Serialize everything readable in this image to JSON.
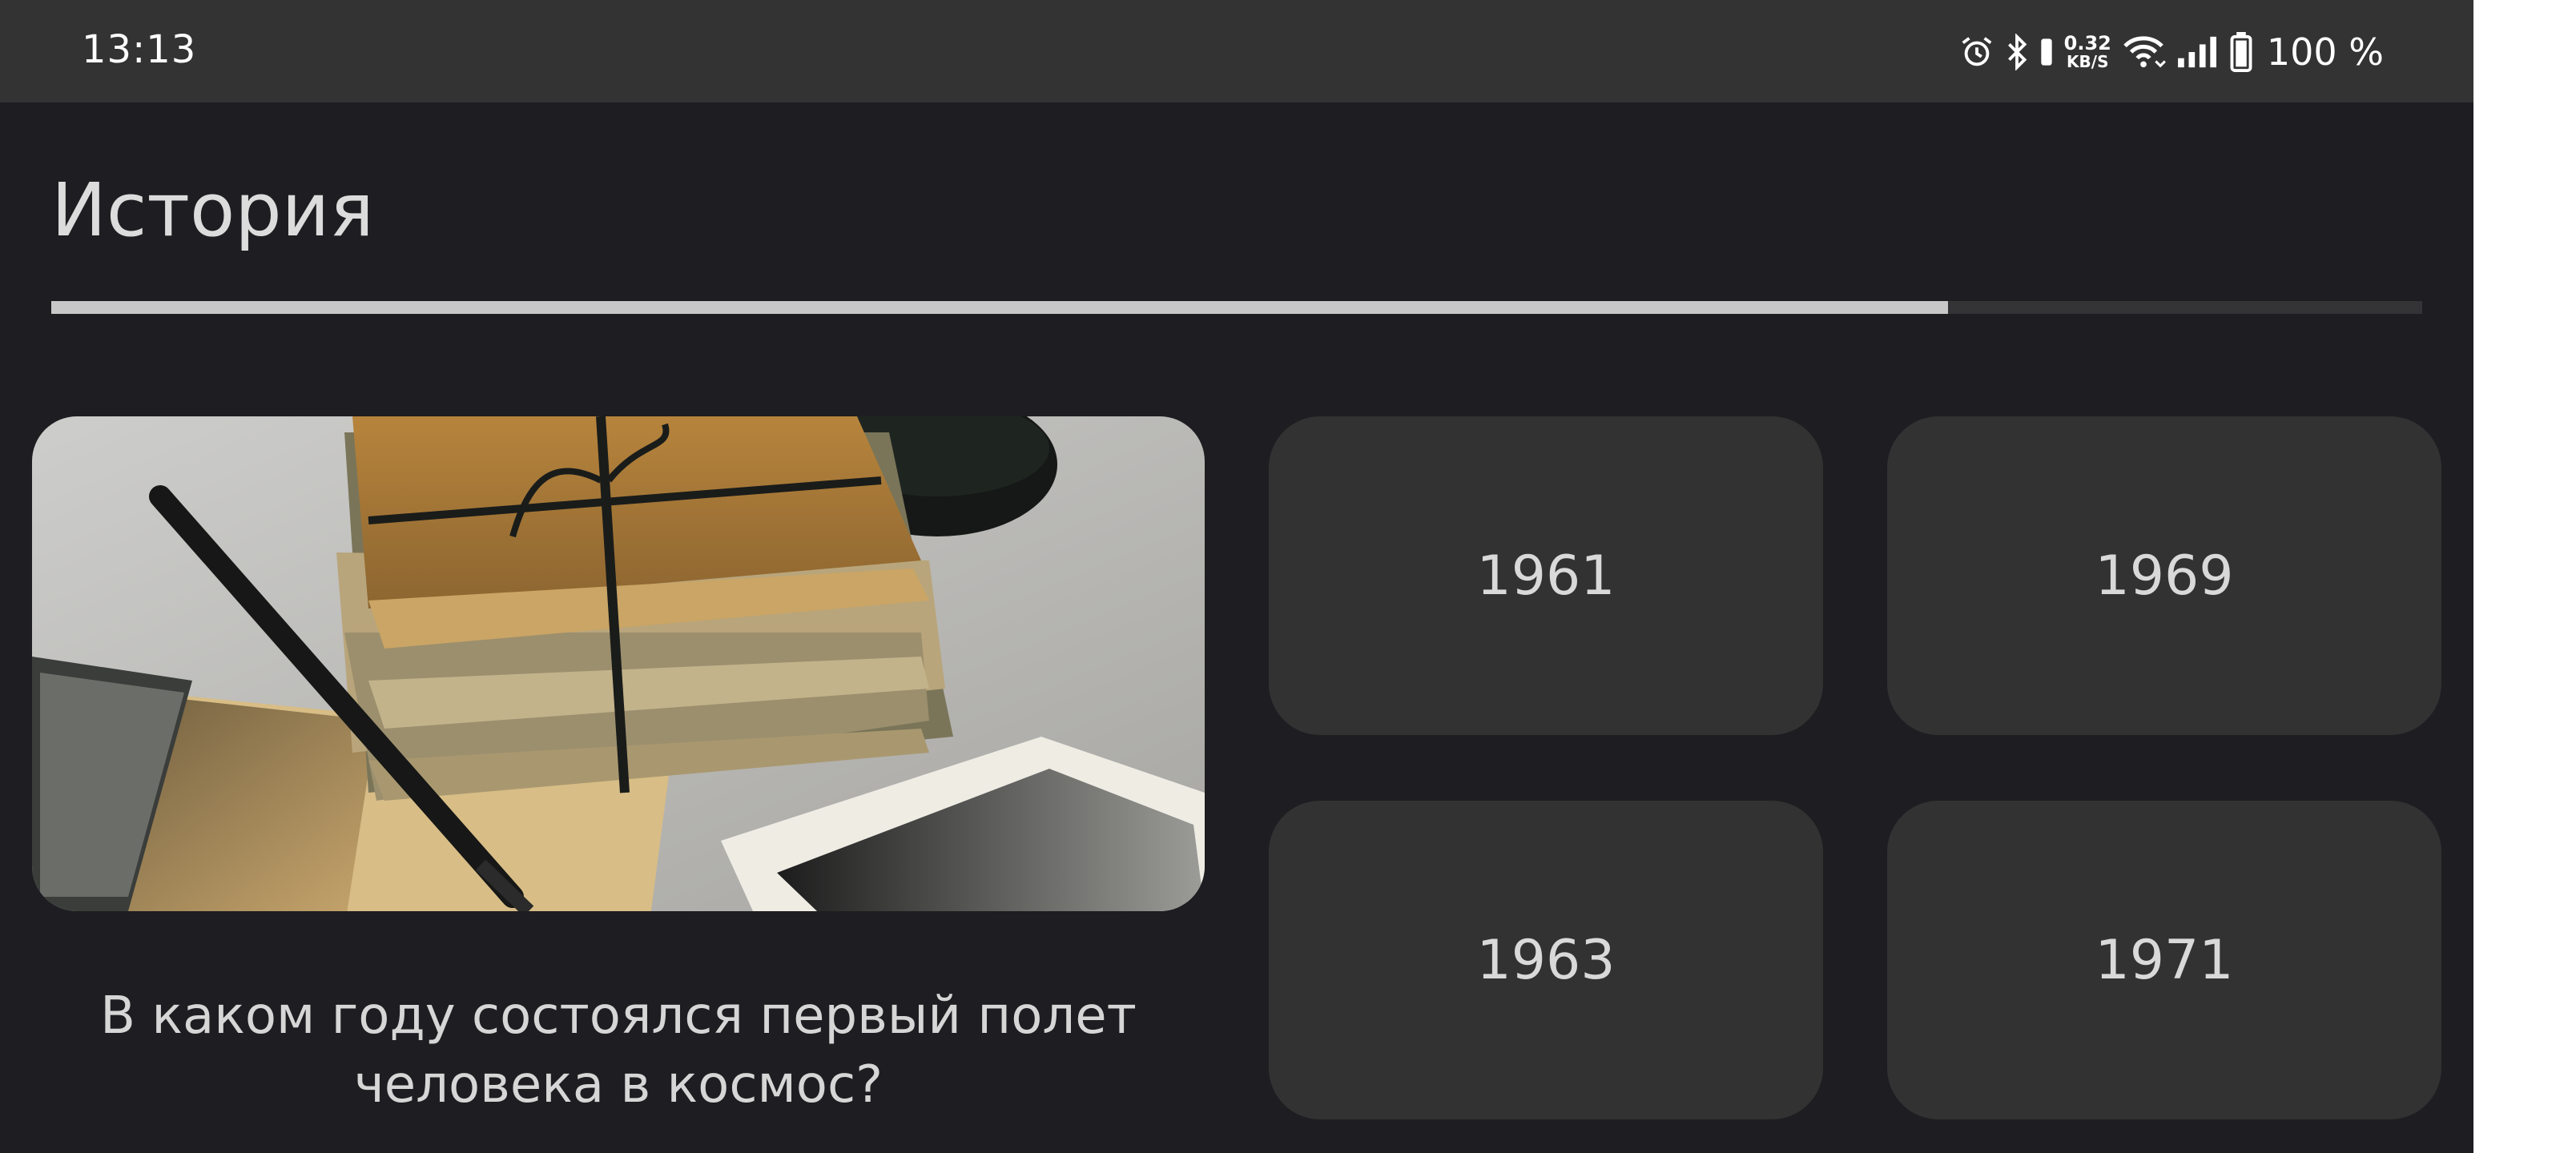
{
  "status_bar": {
    "time": "13:13",
    "net_speed_value": "0.32",
    "net_speed_unit": "KB/S",
    "battery_text": "100 %",
    "icons": [
      "alarm-icon",
      "bluetooth-icon",
      "vibrate-icon",
      "wifi-icon",
      "signal-icon",
      "battery-icon"
    ]
  },
  "quiz": {
    "category_title": "История",
    "progress": 0.8,
    "question": "В каком году состоялся первый полет человека в космос?",
    "image_description_icon": "old-letters-photo",
    "answers": [
      "1961",
      "1969",
      "1963",
      "1971"
    ]
  },
  "colors": {
    "background": "#1e1d21",
    "status_bar": "#333333",
    "answer_card": "#323232",
    "progress_fill": "#c8c8c8",
    "progress_track": "#343336"
  }
}
